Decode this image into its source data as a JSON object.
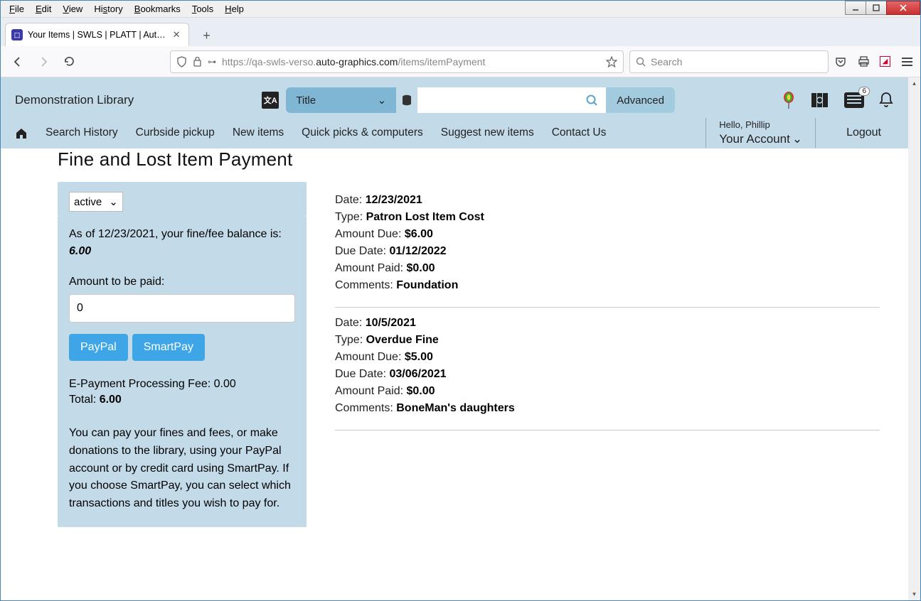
{
  "browser": {
    "menu": [
      "File",
      "Edit",
      "View",
      "History",
      "Bookmarks",
      "Tools",
      "Help"
    ],
    "tab_title": "Your Items | SWLS | PLATT | Aut…",
    "url_prefix": "https://qa-swls-verso.",
    "url_host": "auto-graphics.com",
    "url_path": "/items/itemPayment",
    "search_placeholder": "Search"
  },
  "header": {
    "library_name": "Demonstration Library",
    "search_type": "Title",
    "advanced": "Advanced",
    "list_badge": "6"
  },
  "nav": {
    "items": [
      "Search History",
      "Curbside pickup",
      "New items",
      "Quick picks & computers",
      "Suggest new items",
      "Contact Us"
    ],
    "hello": "Hello, Phillip",
    "account": "Your Account",
    "logout": "Logout"
  },
  "page": {
    "title": "Fine and Lost Item Payment",
    "status_filter": "active",
    "balance_prefix": "As of 12/23/2021, your fine/fee balance is:",
    "balance": "6.00",
    "amount_label": "Amount to be paid:",
    "amount_value": "0",
    "paypal": "PayPal",
    "smartpay": "SmartPay",
    "fee_line": "E-Payment Processing Fee: 0.00",
    "total_label": "Total: ",
    "total_value": "6.00",
    "help": "You can pay your fines and fees, or make donations to the library, using your PayPal account or by credit card using SmartPay. If you choose SmartPay, you can select which transactions and titles you wish to pay for."
  },
  "labels": {
    "date": "Date: ",
    "type": "Type: ",
    "amount_due": "Amount Due: ",
    "due_date": "Due Date: ",
    "amount_paid": "Amount Paid: ",
    "comments": "Comments: "
  },
  "fines": [
    {
      "date": "12/23/2021",
      "type": "Patron Lost Item Cost",
      "amount_due": "$6.00",
      "due_date": "01/12/2022",
      "amount_paid": "$0.00",
      "comments": "Foundation"
    },
    {
      "date": "10/5/2021",
      "type": "Overdue Fine",
      "amount_due": "$5.00",
      "due_date": "03/06/2021",
      "amount_paid": "$0.00",
      "comments": "BoneMan's daughters"
    }
  ]
}
